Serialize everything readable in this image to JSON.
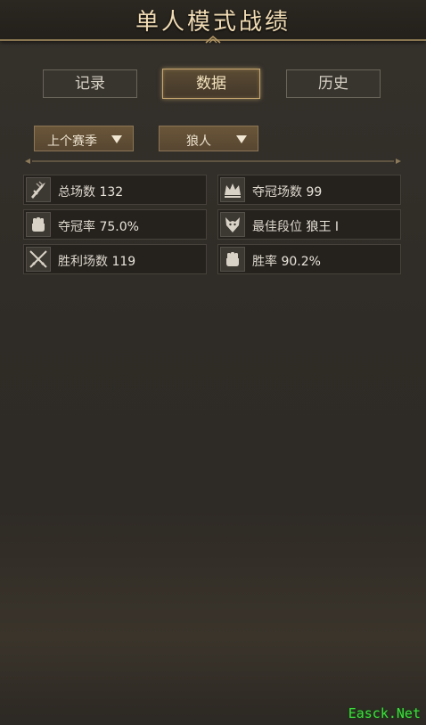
{
  "header": {
    "title": "单人模式战绩"
  },
  "tabs": [
    {
      "label": "记录",
      "active": false
    },
    {
      "label": "数据",
      "active": true
    },
    {
      "label": "历史",
      "active": false
    }
  ],
  "filters": {
    "season": "上个赛季",
    "role": "狼人"
  },
  "stats": [
    {
      "label": "总场数",
      "value": "132",
      "icon": "sword-icon"
    },
    {
      "label": "夺冠场数",
      "value": "99",
      "icon": "crown-icon"
    },
    {
      "label": "夺冠率",
      "value": "75.0%",
      "icon": "fist-icon"
    },
    {
      "label": "最佳段位",
      "value": "狼王 I",
      "icon": "wolf-icon"
    },
    {
      "label": "胜利场数",
      "value": "119",
      "icon": "crossed-swords-icon"
    },
    {
      "label": "胜率",
      "value": "90.2%",
      "icon": "fist-icon"
    }
  ],
  "watermark": "Easck.Net",
  "colors": {
    "accent": "#c7a771",
    "title": "#f1dcb4",
    "dropdown": "#6a5639"
  }
}
